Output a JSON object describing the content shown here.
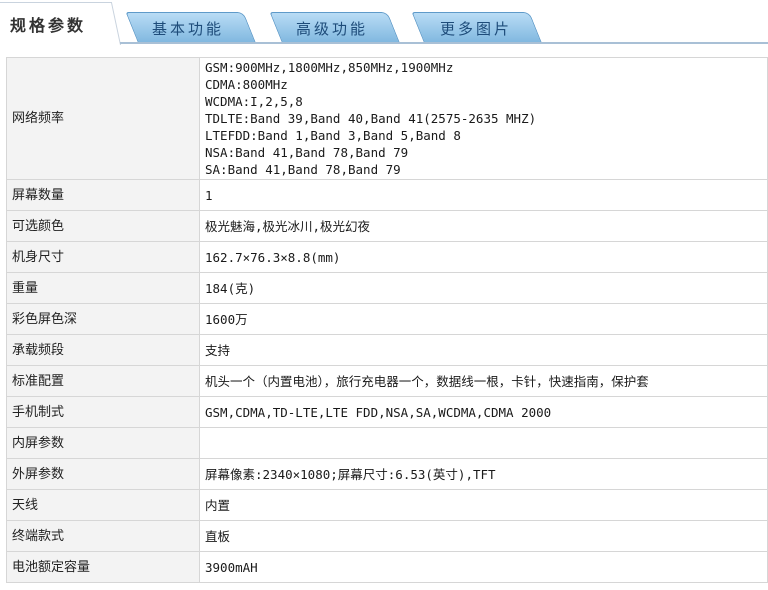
{
  "tabs": {
    "active": "规格参数",
    "items": [
      "基本功能",
      "高级功能",
      "更多图片"
    ]
  },
  "network": {
    "label": "网络频率",
    "lines": [
      "GSM:900MHz,1800MHz,850MHz,1900MHz",
      "CDMA:800MHz",
      "WCDMA:I,2,5,8",
      "TDLTE:Band 39,Band 40,Band 41(2575-2635 MHZ)",
      "LTEFDD:Band 1,Band 3,Band 5,Band 8",
      "NSA:Band 41,Band 78,Band 79",
      "SA:Band 41,Band 78,Band 79"
    ]
  },
  "rows": [
    {
      "label": "屏幕数量",
      "value": "1"
    },
    {
      "label": "可选颜色",
      "value": "极光魅海,极光冰川,极光幻夜"
    },
    {
      "label": "机身尺寸",
      "value": "162.7×76.3×8.8(mm)"
    },
    {
      "label": "重量",
      "value": "184(克)"
    },
    {
      "label": "彩色屏色深",
      "value": "1600万"
    },
    {
      "label": "承载频段",
      "value": "支持"
    },
    {
      "label": "标准配置",
      "value": "机头一个（内置电池），旅行充电器一个，数据线一根，卡针，快速指南，保护套"
    },
    {
      "label": "手机制式",
      "value": "GSM,CDMA,TD-LTE,LTE FDD,NSA,SA,WCDMA,CDMA 2000"
    },
    {
      "label": "内屏参数",
      "value": ""
    },
    {
      "label": "外屏参数",
      "value": "屏幕像素:2340×1080;屏幕尺寸:6.53(英寸),TFT"
    },
    {
      "label": "天线",
      "value": "内置"
    },
    {
      "label": "终端款式",
      "value": "直板"
    },
    {
      "label": "电池额定容量",
      "value": "3900mAH"
    }
  ]
}
